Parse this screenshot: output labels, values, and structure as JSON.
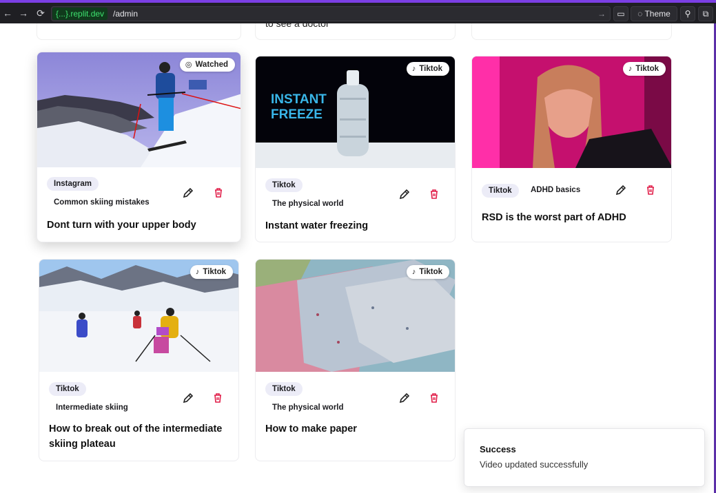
{
  "browser": {
    "domain": "{...}.replit.dev",
    "path": "/admin",
    "theme_label": "Theme"
  },
  "remnants": [
    {
      "text": ""
    },
    {
      "text": "to see a doctor"
    },
    {
      "text": ""
    }
  ],
  "cards": [
    {
      "status_badge": "Watched",
      "platform": "Instagram",
      "topic": "Common skiing mistakes",
      "title": "Dont turn with your upper body"
    },
    {
      "status_badge": "Tiktok",
      "platform": "Tiktok",
      "topic": "The physical world",
      "title": "Instant water freezing",
      "thumb_text": "INSTANT FREEZE"
    },
    {
      "status_badge": "Tiktok",
      "platform": "Tiktok",
      "topic": "ADHD basics",
      "title": "RSD is the worst part of ADHD"
    },
    {
      "status_badge": "Tiktok",
      "platform": "Tiktok",
      "topic": "Intermediate skiing",
      "title": "How to break out of the intermediate skiing plateau"
    },
    {
      "status_badge": "Tiktok",
      "platform": "Tiktok",
      "topic": "The physical world",
      "title": "How to make paper"
    }
  ],
  "toast": {
    "title": "Success",
    "message": "Video updated successfully"
  },
  "colors": {
    "accent": "#7b3fe4",
    "delete": "#e11d48",
    "tag_bg": "#ececf7"
  }
}
